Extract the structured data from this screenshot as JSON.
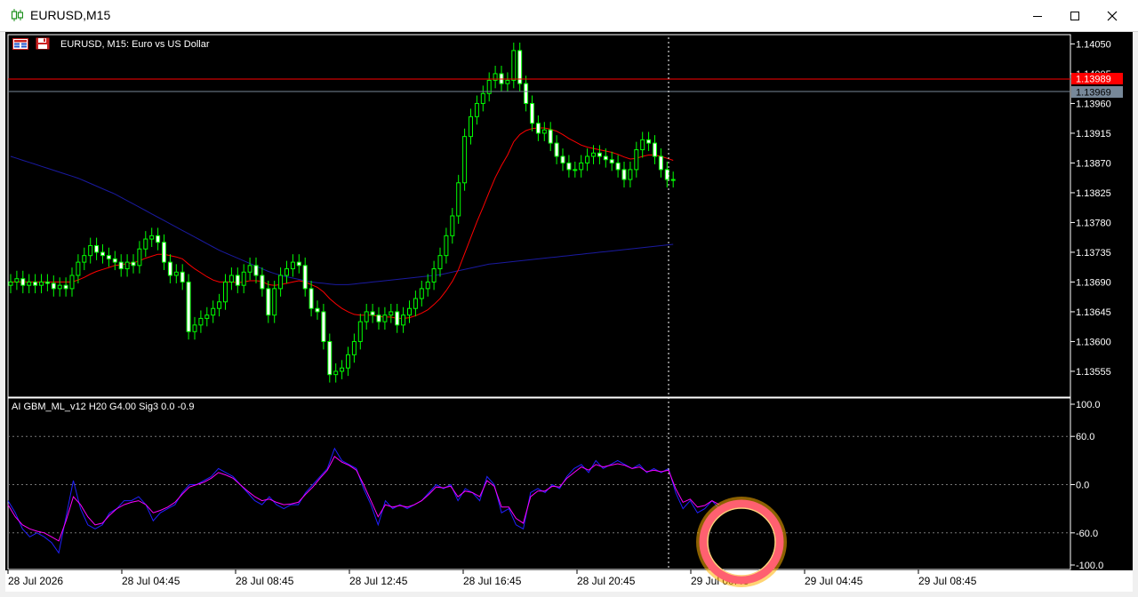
{
  "window": {
    "title": "EURUSD,M15",
    "minimize_icon": "minimize-icon",
    "maximize_icon": "maximize-icon",
    "close_icon": "close-icon"
  },
  "main_chart": {
    "symbol_label": "EURUSD, M15:  Euro vs US Dollar",
    "price_axis_ticks": [
      "1.14050",
      "1.14005",
      "1.13960",
      "1.13915",
      "1.13870",
      "1.13825",
      "1.13780",
      "1.13735",
      "1.13690",
      "1.13645",
      "1.13600",
      "1.13555"
    ],
    "bid_line": {
      "price": "1.13989",
      "color": "#ff0000"
    },
    "ask_line": {
      "price": "1.13969",
      "color": "#778899"
    },
    "candle_color": "#00ff00",
    "ma_fast_color": "#ff0000",
    "ma_slow_color": "#1a1aa0",
    "crosshair_color": "#ffffff"
  },
  "indicator": {
    "label": "AI GBM_ML_v12 H20 G4.00 Sig3 0.0 -0.9",
    "axis_ticks": [
      "100.0",
      "60.0",
      "0.0",
      "-60.0",
      "-100.0"
    ],
    "line1_color": "#2020ff",
    "line2_color": "#ff00ff",
    "highlight_ring_color": "#ff6070"
  },
  "time_axis": {
    "labels": [
      "28 Jul 2026",
      "28 Jul 04:45",
      "28 Jul 08:45",
      "28 Jul 12:45",
      "28 Jul 16:45",
      "28 Jul 20:45",
      "29 Jul 00:45",
      "29 Jul 04:45",
      "29 Jul 08:45"
    ]
  },
  "chart_data": {
    "type": "candlestick",
    "title": "EURUSD, M15:  Euro vs US Dollar",
    "ylim": [
      1.1352,
      1.1406
    ],
    "x_labels": [
      "28 Jul 2026",
      "28 Jul 04:45",
      "28 Jul 08:45",
      "28 Jul 12:45",
      "28 Jul 16:45",
      "28 Jul 20:45",
      "29 Jul 00:45",
      "29 Jul 04:45",
      "29 Jul 08:45"
    ],
    "close": [
      1.1369,
      1.13695,
      1.13685,
      1.1369,
      1.13685,
      1.1369,
      1.13688,
      1.1368,
      1.13685,
      1.1368,
      1.137,
      1.1372,
      1.1373,
      1.13745,
      1.13735,
      1.1373,
      1.13725,
      1.1372,
      1.1371,
      1.1372,
      1.13715,
      1.1374,
      1.13755,
      1.1376,
      1.1375,
      1.1372,
      1.137,
      1.13705,
      1.1369,
      1.13615,
      1.13625,
      1.13635,
      1.1364,
      1.1365,
      1.1366,
      1.1369,
      1.137,
      1.13685,
      1.13705,
      1.13715,
      1.137,
      1.1368,
      1.1364,
      1.1368,
      1.137,
      1.1371,
      1.1372,
      1.13715,
      1.1368,
      1.1365,
      1.13645,
      1.136,
      1.1355,
      1.13555,
      1.1356,
      1.1358,
      1.136,
      1.1363,
      1.13645,
      1.1364,
      1.1363,
      1.1364,
      1.13645,
      1.13625,
      1.1364,
      1.1365,
      1.13665,
      1.1368,
      1.1369,
      1.1371,
      1.1373,
      1.1376,
      1.1379,
      1.1384,
      1.1391,
      1.1394,
      1.1396,
      1.13975,
      1.13995,
      1.14005,
      1.1399,
      1.13995,
      1.1404,
      1.1399,
      1.1396,
      1.1393,
      1.13915,
      1.1392,
      1.139,
      1.1388,
      1.1387,
      1.1386,
      1.1386,
      1.1387,
      1.1388,
      1.13885,
      1.1388,
      1.13875,
      1.1387,
      1.1386,
      1.13845,
      1.1386,
      1.1389,
      1.13905,
      1.139,
      1.1388,
      1.1386,
      1.13845,
      1.13845
    ],
    "open": [
      1.13685,
      1.1369,
      1.13695,
      1.13685,
      1.1369,
      1.13685,
      1.1369,
      1.13688,
      1.1368,
      1.13685,
      1.1368,
      1.137,
      1.1372,
      1.1373,
      1.13745,
      1.13735,
      1.1373,
      1.13725,
      1.1372,
      1.1371,
      1.1372,
      1.13715,
      1.1374,
      1.13755,
      1.1376,
      1.1375,
      1.1372,
      1.137,
      1.13705,
      1.1369,
      1.13615,
      1.13625,
      1.13635,
      1.1364,
      1.1365,
      1.1366,
      1.1369,
      1.137,
      1.13685,
      1.13705,
      1.13715,
      1.137,
      1.1368,
      1.1364,
      1.1368,
      1.137,
      1.1371,
      1.1372,
      1.13715,
      1.1368,
      1.1365,
      1.13645,
      1.136,
      1.1355,
      1.13555,
      1.1356,
      1.1358,
      1.136,
      1.1363,
      1.13645,
      1.1364,
      1.1363,
      1.1364,
      1.13645,
      1.13625,
      1.1364,
      1.1365,
      1.13665,
      1.1368,
      1.1369,
      1.1371,
      1.1373,
      1.1376,
      1.1379,
      1.1384,
      1.1391,
      1.1394,
      1.1396,
      1.13975,
      1.13995,
      1.14005,
      1.1399,
      1.13995,
      1.1404,
      1.1399,
      1.1396,
      1.1393,
      1.13915,
      1.1392,
      1.139,
      1.1388,
      1.1387,
      1.1386,
      1.1386,
      1.1387,
      1.1388,
      1.13885,
      1.1388,
      1.13875,
      1.1387,
      1.1386,
      1.13845,
      1.1386,
      1.1389,
      1.13905,
      1.139,
      1.1388,
      1.1386,
      1.13845
    ],
    "ma_fast": [
      1.1369,
      1.1369,
      1.1369,
      1.1369,
      1.1369,
      1.1369,
      1.1369,
      1.1369,
      1.1369,
      1.1369,
      1.1369,
      1.13693,
      1.13697,
      1.13702,
      1.13706,
      1.13709,
      1.13712,
      1.13715,
      1.13716,
      1.13718,
      1.13719,
      1.13722,
      1.13726,
      1.13729,
      1.13732,
      1.13732,
      1.1373,
      1.13728,
      1.13725,
      1.13717,
      1.1371,
      1.13704,
      1.13698,
      1.13693,
      1.1369,
      1.1369,
      1.1369,
      1.13689,
      1.1369,
      1.13692,
      1.13692,
      1.13691,
      1.13686,
      1.13685,
      1.13686,
      1.13688,
      1.1369,
      1.13692,
      1.1369,
      1.13686,
      1.13682,
      1.13675,
      1.13665,
      1.13657,
      1.1365,
      1.13645,
      1.13641,
      1.1364,
      1.1364,
      1.1364,
      1.13638,
      1.13637,
      1.13637,
      1.13635,
      1.13635,
      1.13636,
      1.13639,
      1.13643,
      1.13648,
      1.13656,
      1.13665,
      1.13677,
      1.13691,
      1.13709,
      1.13733,
      1.13757,
      1.13781,
      1.13803,
      1.13826,
      1.13848,
      1.13866,
      1.13882,
      1.13902,
      1.13913,
      1.13919,
      1.13922,
      1.13923,
      1.13923,
      1.13921,
      1.13918,
      1.13913,
      1.13907,
      1.13902,
      1.13897,
      1.13894,
      1.13892,
      1.1389,
      1.13888,
      1.13886,
      1.13883,
      1.13879,
      1.13876,
      1.13877,
      1.1388,
      1.13882,
      1.13882,
      1.1388,
      1.13877,
      1.13874
    ],
    "ma_slow": [
      1.1388,
      1.13877,
      1.13874,
      1.13871,
      1.13868,
      1.13865,
      1.13862,
      1.13859,
      1.13856,
      1.13853,
      1.1385,
      1.13847,
      1.13843,
      1.13839,
      1.13835,
      1.13831,
      1.13827,
      1.13823,
      1.13818,
      1.13813,
      1.13808,
      1.13803,
      1.13798,
      1.13793,
      1.13788,
      1.13783,
      1.13778,
      1.13773,
      1.13768,
      1.13763,
      1.13758,
      1.13753,
      1.13748,
      1.13743,
      1.13738,
      1.13734,
      1.1373,
      1.13726,
      1.13722,
      1.13718,
      1.13714,
      1.1371,
      1.13706,
      1.13703,
      1.137,
      1.13698,
      1.13696,
      1.13694,
      1.13692,
      1.1369,
      1.13689,
      1.13688,
      1.13687,
      1.13686,
      1.13686,
      1.13686,
      1.13687,
      1.13688,
      1.13689,
      1.1369,
      1.13691,
      1.13692,
      1.13693,
      1.13694,
      1.13695,
      1.13696,
      1.13697,
      1.13698,
      1.13699,
      1.137,
      1.13701,
      1.13703,
      1.13705,
      1.13707,
      1.13709,
      1.13711,
      1.13713,
      1.13715,
      1.13717,
      1.13718,
      1.13719,
      1.1372,
      1.13721,
      1.13722,
      1.13723,
      1.13724,
      1.13725,
      1.13726,
      1.13727,
      1.13728,
      1.13729,
      1.1373,
      1.13731,
      1.13732,
      1.13733,
      1.13734,
      1.13735,
      1.13736,
      1.13737,
      1.13738,
      1.13739,
      1.1374,
      1.13741,
      1.13742,
      1.13743,
      1.13744,
      1.13745,
      1.13746,
      1.13747
    ],
    "indicator_ylim": [
      -100,
      100
    ],
    "indicator_line1": [
      -20,
      -35,
      -55,
      -65,
      -60,
      -65,
      -72,
      -85,
      -40,
      5,
      -30,
      -50,
      -55,
      -50,
      -35,
      -30,
      -20,
      -20,
      -15,
      -25,
      -45,
      -35,
      -30,
      -25,
      -10,
      0,
      0,
      5,
      10,
      20,
      15,
      10,
      0,
      -10,
      -20,
      -25,
      -15,
      -25,
      -30,
      -25,
      -25,
      -10,
      0,
      10,
      20,
      45,
      30,
      25,
      20,
      -5,
      -25,
      -50,
      -20,
      -30,
      -25,
      -30,
      -25,
      -20,
      -10,
      0,
      -5,
      0,
      -20,
      -5,
      -10,
      -20,
      10,
      0,
      -35,
      -30,
      -50,
      -55,
      -10,
      -5,
      -10,
      0,
      -5,
      10,
      20,
      25,
      15,
      30,
      20,
      25,
      30,
      25,
      20,
      25,
      15,
      20,
      15,
      20,
      -10,
      -30,
      -20,
      -35,
      -30,
      -20,
      -30
    ],
    "indicator_line2": [
      -25,
      -40,
      -50,
      -55,
      -58,
      -60,
      -65,
      -70,
      -45,
      -15,
      -25,
      -40,
      -50,
      -48,
      -38,
      -30,
      -25,
      -22,
      -20,
      -25,
      -35,
      -32,
      -28,
      -22,
      -12,
      -3,
      0,
      3,
      8,
      15,
      12,
      8,
      0,
      -8,
      -15,
      -20,
      -18,
      -22,
      -25,
      -24,
      -22,
      -12,
      -3,
      8,
      18,
      35,
      28,
      24,
      18,
      0,
      -20,
      -40,
      -25,
      -28,
      -26,
      -28,
      -25,
      -20,
      -12,
      -3,
      -4,
      -2,
      -15,
      -8,
      -10,
      -15,
      5,
      -2,
      -28,
      -28,
      -42,
      -48,
      -15,
      -8,
      -8,
      -2,
      -3,
      8,
      15,
      22,
      18,
      25,
      22,
      24,
      26,
      24,
      20,
      22,
      16,
      18,
      16,
      18,
      -5,
      -22,
      -18,
      -28,
      -26,
      -20,
      -25
    ]
  }
}
